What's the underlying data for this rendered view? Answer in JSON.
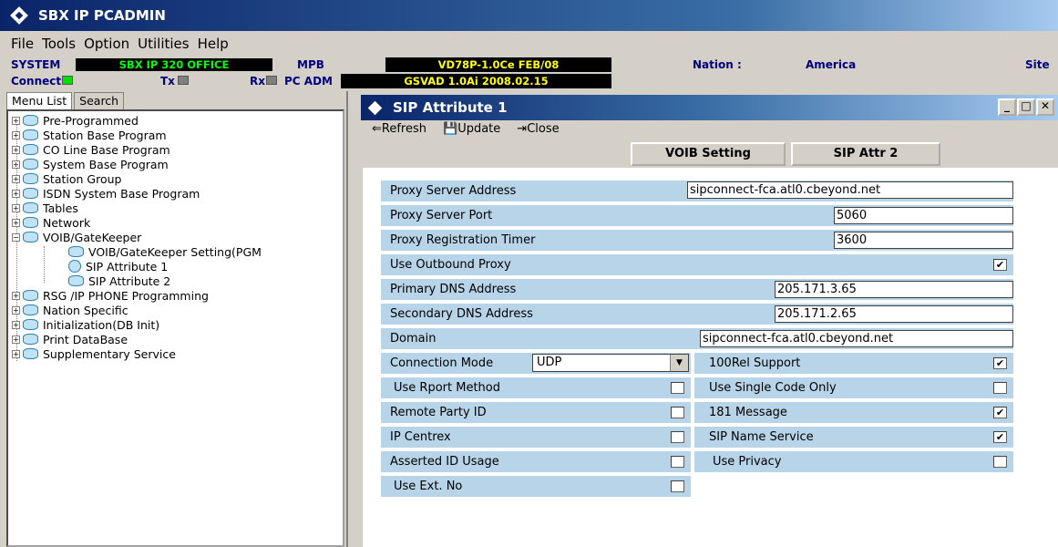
{
  "app": {
    "title": "SBX IP PCADMIN"
  },
  "menu": [
    "File",
    "Tools",
    "Option",
    "Utilities",
    "Help"
  ],
  "status": {
    "system_label": "SYSTEM",
    "system_value": "SBX IP 320 OFFICE",
    "mpb_label": "MPB",
    "mpb_value": "VD78P-1.0Ce FEB/08",
    "nation_label": "Nation :",
    "nation_value": "America",
    "site_label": "Site",
    "connect_label": "Connect",
    "tx_label": "Tx",
    "rx_label": "Rx",
    "pcadm_label": "PC ADM",
    "pcadm_value": "GSVAD 1.0Ai 2008.02.15"
  },
  "left_tabs": [
    "Menu List",
    "Search"
  ],
  "tree": {
    "items": [
      "Pre-Programmed",
      "Station Base Program",
      "CO Line Base Program",
      "System Base Program",
      "Station Group",
      "ISDN System Base Program",
      "Tables",
      "Network",
      "VOIB/GateKeeper",
      "VOIB/GateKeeper Setting(PGM",
      "SIP Attribute 1",
      "SIP Attribute 2",
      "RSG /IP PHONE Programming",
      "Nation Specific",
      "Initialization(DB Init)",
      "Print DataBase",
      "Supplementary Service"
    ]
  },
  "dialog": {
    "title": "SIP Attribute 1",
    "toolbar": {
      "refresh": "Refresh",
      "update": "Update",
      "close": "Close"
    },
    "buttons": {
      "voib": "VOIB Setting",
      "sip2": "SIP Attr 2"
    },
    "fields": {
      "proxy_server_address": {
        "label": "Proxy Server Address",
        "value": "sipconnect-fca.atl0.cbeyond.net"
      },
      "proxy_server_port": {
        "label": "Proxy Server Port",
        "value": "5060"
      },
      "proxy_registration_timer": {
        "label": "Proxy Registration Timer",
        "value": "3600"
      },
      "use_outbound_proxy": {
        "label": "Use Outbound Proxy",
        "checked": true
      },
      "primary_dns": {
        "label": "Primary DNS Address",
        "value": "205.171.3.65"
      },
      "secondary_dns": {
        "label": "Secondary DNS Address",
        "value": "205.171.2.65"
      },
      "domain": {
        "label": "Domain",
        "value": "sipconnect-fca.atl0.cbeyond.net"
      },
      "connection_mode": {
        "label": "Connection Mode",
        "value": "UDP"
      }
    },
    "left_checks": [
      {
        "label": "Use Rport Method",
        "checked": false
      },
      {
        "label": "Remote Party ID",
        "checked": false
      },
      {
        "label": "IP Centrex",
        "checked": false
      },
      {
        "label": "Asserted ID Usage",
        "checked": false
      },
      {
        "label": "Use Ext. No",
        "checked": false
      }
    ],
    "right_checks": [
      {
        "label": "100Rel Support",
        "checked": true
      },
      {
        "label": "Use Single Code Only",
        "checked": false
      },
      {
        "label": "181 Message",
        "checked": true
      },
      {
        "label": "SIP Name Service",
        "checked": true
      },
      {
        "label": "Use Privacy",
        "checked": false
      }
    ]
  }
}
